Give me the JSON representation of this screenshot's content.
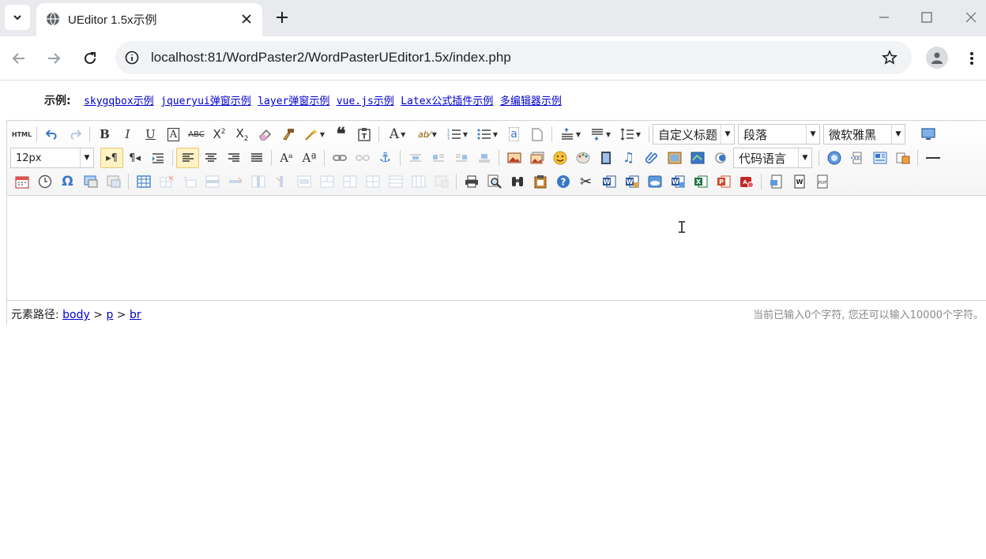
{
  "browser": {
    "tab_title": "UEditor 1.5x示例",
    "url": "localhost:81/WordPaster2/WordPasterUEditor1.5x/index.php"
  },
  "page": {
    "examples_label": "示例:",
    "example_links": [
      "skygqbox示例",
      "jqueryui弹窗示例",
      "layer弹窗示例",
      "vue.js示例",
      "Latex公式插件示例",
      "多编辑器示例"
    ]
  },
  "editor": {
    "html_button": "HTML",
    "font_size": "12px",
    "heading_select": "自定义标题",
    "paragraph_select": "段落",
    "font_family": "微软雅黑",
    "code_language": "代码语言",
    "status": {
      "path_label": "元素路径:",
      "path": [
        "body",
        "p",
        "br"
      ],
      "separator": ">",
      "word_count": "当前已输入0个字符, 您还可以输入10000个字符。"
    }
  },
  "colors": {
    "link": "#0000cc",
    "tab_bar": "#e8eaed",
    "omnibox": "#f1f3f4",
    "active_button": "#fff3c4"
  }
}
